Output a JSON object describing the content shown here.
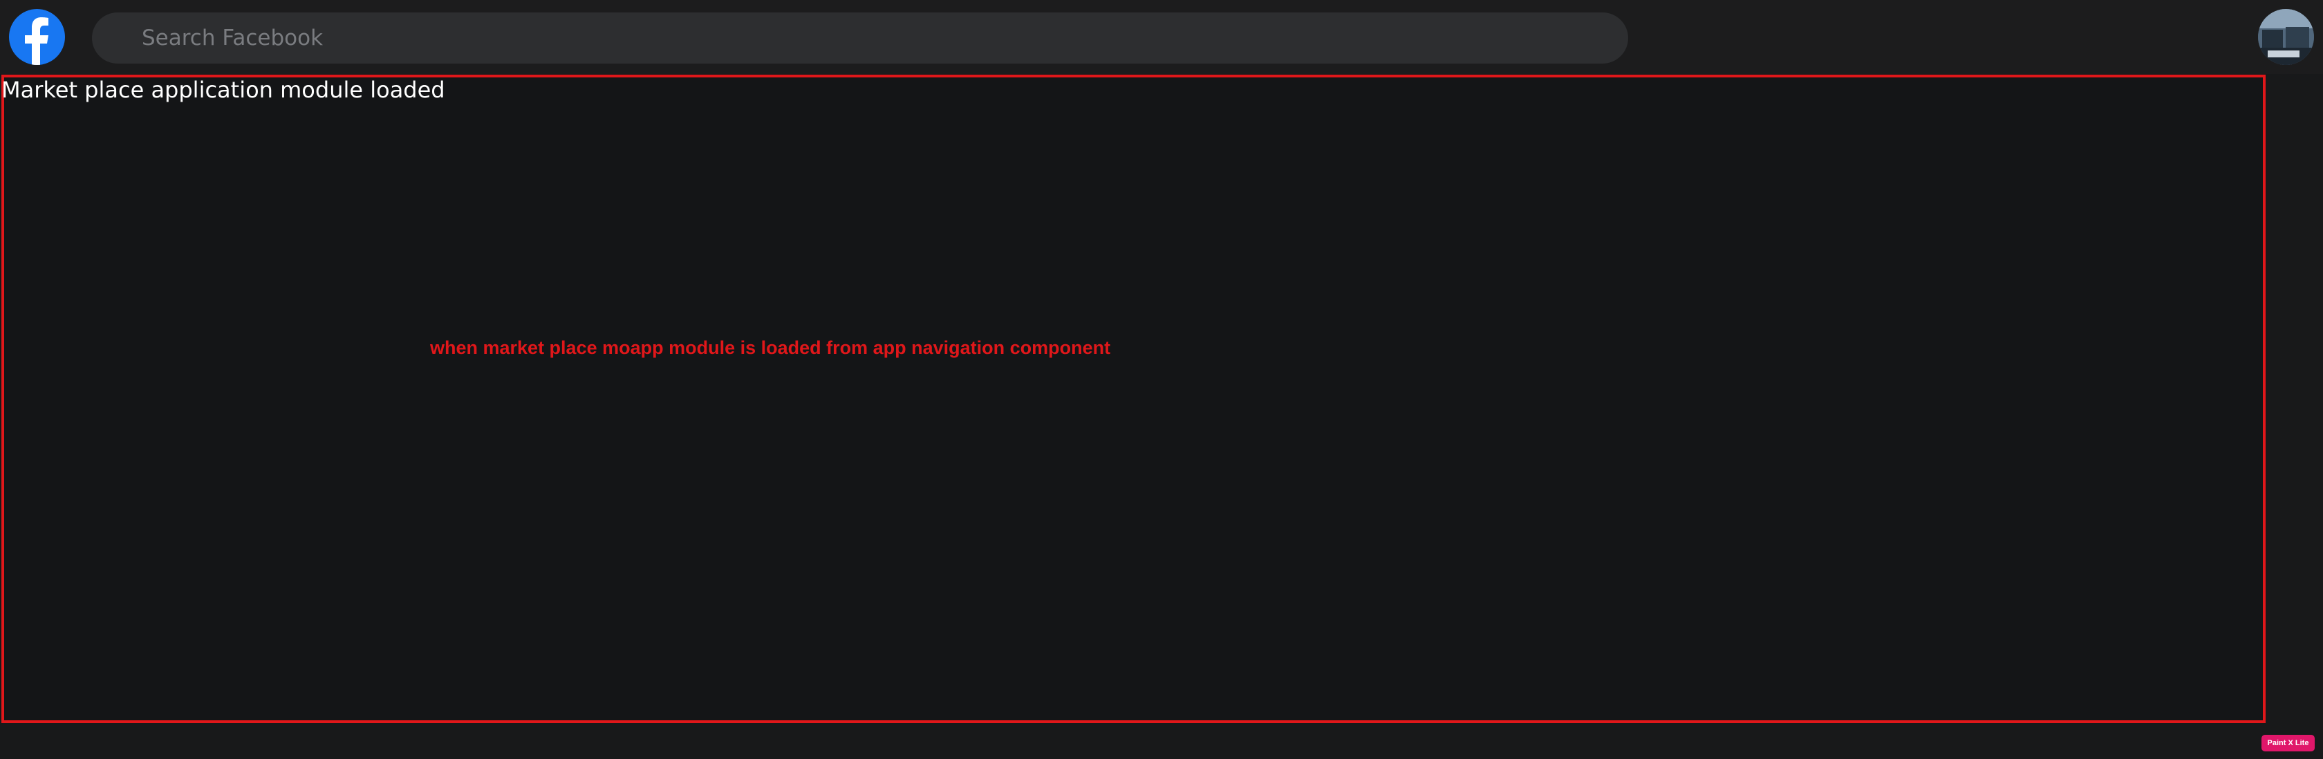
{
  "header": {
    "logo_icon": "facebook-logo-icon",
    "search": {
      "placeholder": "Search Facebook",
      "value": ""
    },
    "avatar_icon": "profile-avatar-icon"
  },
  "main": {
    "module_title": "Market place application module loaded",
    "annotation": "when market place moapp module is loaded from app navigation component"
  },
  "badge": {
    "label": "Paint X Lite"
  },
  "colors": {
    "brand": "#1877f2",
    "highlight": "#e0171a",
    "badge": "#e0176a",
    "background": "#18191a"
  }
}
